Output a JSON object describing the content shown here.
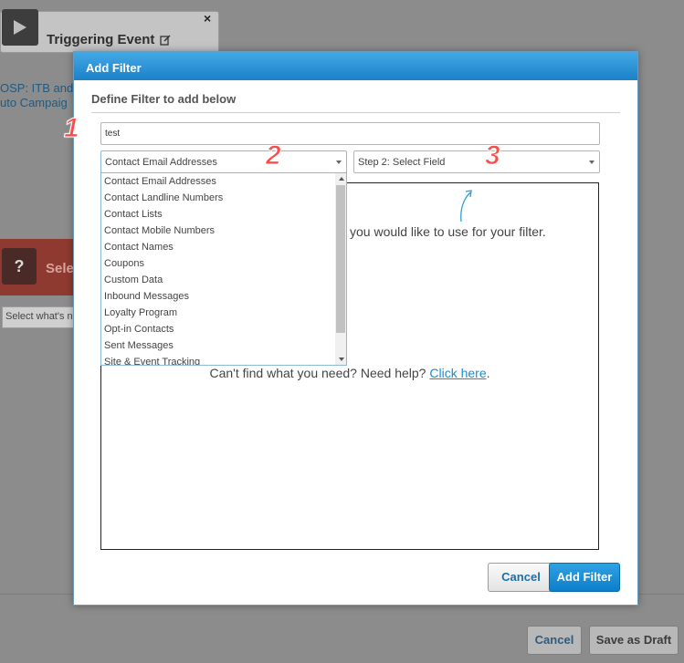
{
  "background": {
    "trigger_title": "Triggering Event",
    "close_symbol": "×",
    "campaign_line1": "OSP: ITB and",
    "campaign_line2": "uto Campaig",
    "question_mark": "?",
    "select_label": "Sele",
    "select_placeholder": "Select what's ne",
    "cancel_label": "Cancel",
    "save_draft_label": "Save as Draft"
  },
  "modal": {
    "title": "Add Filter",
    "subtitle": "Define Filter to add below",
    "name_value": "test",
    "type_select_value": "Contact Email Addresses",
    "field_select_value": "Step 2: Select Field",
    "hint_text": "you would like to use for your filter.",
    "help_text": "Can't find what you need? Need help?",
    "help_link": "Click here",
    "help_period": ".",
    "cancel_label": "Cancel",
    "add_label": "Add Filter"
  },
  "dropdown": {
    "options": [
      "Contact Email Addresses",
      "Contact Landline Numbers",
      "Contact Lists",
      "Contact Mobile Numbers",
      "Contact Names",
      "Coupons",
      "Custom Data",
      "Inbound Messages",
      "Loyalty Program",
      "Opt-in Contacts",
      "Sent Messages",
      "Site & Event Tracking"
    ]
  },
  "annotations": [
    "1",
    "2",
    "3"
  ],
  "colors": {
    "header_blue": "#1b82c9",
    "link_blue": "#1a8ccf",
    "annotation_red": "#ff4a4a"
  }
}
